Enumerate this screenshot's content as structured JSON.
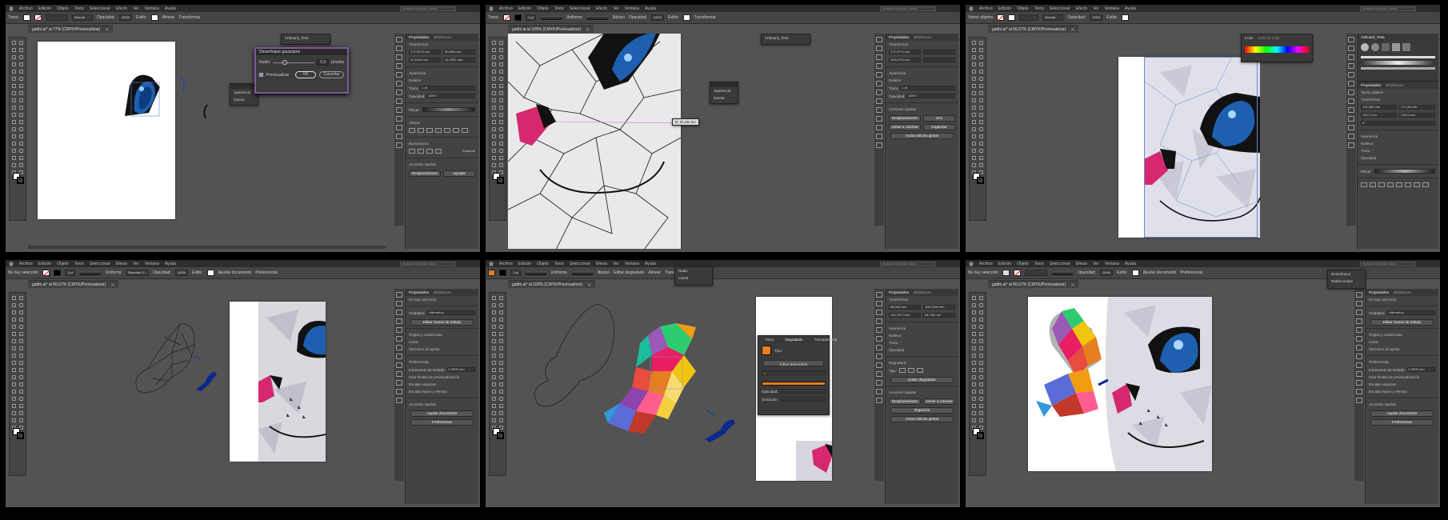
{
  "common": {
    "menu": [
      "Archivo",
      "Edición",
      "Objeto",
      "Texto",
      "Seleccionar",
      "Efecto",
      "Ver",
      "Ventana",
      "Ayuda"
    ],
    "search_placeholder": "Buscar en Adobe Stock",
    "trazo_label": "Trazo:",
    "opacidad_label": "Opacidad:",
    "opacidad_value": "100%",
    "estilo_label": "Estilo:",
    "alinear_label": "Alinear",
    "transformar_label": "Transformar",
    "pt_value": "1 pt",
    "uniforme": "Uniforme",
    "basico": "Básico",
    "props_tab": "Propiedades",
    "biblio_tab": "Bibliotecas",
    "apariencia": "Apariencia",
    "relleno": "Relleno",
    "trazo": "Trazo",
    "opacidad": "Opacidad",
    "transformar": "Transformar",
    "acciones": "Acciones rápidas",
    "desplazamiento": "Desplazamiento",
    "agrupar": "Agrupar",
    "unidades": "Unidades:",
    "milimetros": "Milímetros",
    "ninguna_sel": "No hay selección",
    "editar_mesas": "Editar mesas de trabajo",
    "ajustar_doc": "Ajustar documento",
    "preferencias": "Preferencias",
    "reglas": "Reglas y cuadrículas",
    "guias": "Guías",
    "opciones_ajuste": "Opciones de ajuste",
    "incremento": "Incremento de teclado",
    "incr_val": "0,3528 mm",
    "usar_limites": "Usar límites de previsualización",
    "escalar_esquinas": "Escalar esquinas",
    "escalar_trazos": "Escalar trazos y efectos",
    "ninguna_corta": "No hay selección"
  },
  "frames": [
    {
      "tab": "gatito.ai* al 77% (CMYK/Previsualizar)",
      "mode": "Normal",
      "float_panel": [
        "Artboard_Tinta"
      ],
      "mini_panel": [
        "Apariencia",
        "Garras"
      ],
      "dialog": {
        "title": "Desenfoque gaussiano",
        "label": "Radio:",
        "value": "5,5",
        "unit": "píxeles",
        "preview": "Previsualizar",
        "ok": "OK",
        "cancel": "Cancelar"
      },
      "panel": {
        "x": "172,5274 mm",
        "y": "47,2418 mm",
        "w": "40,606 mm",
        "h": "41,4251 mm",
        "pt": "1 pt",
        "op": "100%",
        "pincel": "Pincel:",
        "alinear": "Alinear",
        "buscatrazos": "Buscatrazos",
        "expandir": "Expandir"
      }
    },
    {
      "tab": "gatito.ai al 100% (CMYK/Previsualizar)",
      "float_panel": [
        "Artboard_Tinta"
      ],
      "mini_panel": [
        "Apariencia",
        "Garras"
      ],
      "measure": "D: 31,48 mm",
      "panel": {
        "x": "172,9774 mm",
        "y": "109,4723 mm",
        "pt": "1 pt",
        "op": "100%",
        "desplaz": "Desplazamiento",
        "unir": "Unir",
        "volver": "Volver a colorear",
        "ordenar": "Organizar",
        "iniciar": "Iniciar edición global"
      }
    },
    {
      "tab": "gatito.ai* al 66,67% (CMYK/Previsualizar)",
      "mode": "Normal",
      "color_panel": [
        "Color",
        "Guía de color"
      ],
      "brushes_title": "Artboard_Tinta",
      "panel": {
        "sel": "Varios objetos",
        "x": "130,365 mm",
        "y": "120,7 mm",
        "w": "171,33 mm",
        "h": "176,4 mm",
        "angle": "0°",
        "opacidad": "Opacidad",
        "pincel": "Pincel:"
      }
    },
    {
      "tab": "gatito.ai* al 66,67% (CMYK/Previsualizar)",
      "brush_label": "Redondo 3...",
      "panel": {}
    },
    {
      "tab": "gatito.ai* al 100% (CMYK/Previsualizar)",
      "dropdown": [
        "Radio",
        "Lineal"
      ],
      "editar_degradado": "Editar degradado",
      "grad_tabs": [
        "Trazo",
        "Degradado",
        "Transparencia"
      ],
      "grad_type": "Tipo:",
      "grad_edit": "Editar degradado",
      "grad_angle": "0°",
      "grad_opac": "Opacidad:",
      "grad_loc": "Ubicación:",
      "panel": {
        "x": "86,094 mm",
        "y": "140,7577 mm",
        "w": "106,1396 mm",
        "h": "84,738 mm",
        "degradado": "Degradado",
        "tipo": "Tipo:",
        "edit": "Editar degradado",
        "desplaz": "Desplazamiento",
        "volver": "Volver a colorear",
        "ordenar": "Organizar",
        "iniciar": "Iniciar edición global"
      }
    },
    {
      "tab": "gatito.ai* al 66,67% (CMYK/Previsualizar)",
      "dropdown": [
        "Desenfoque",
        "Radial simple"
      ],
      "panel": {}
    }
  ],
  "colors": {
    "ui_bg": "#535353",
    "eye": "#1e5fb0",
    "pink": "#d6286e",
    "orange": "#e67e22"
  }
}
